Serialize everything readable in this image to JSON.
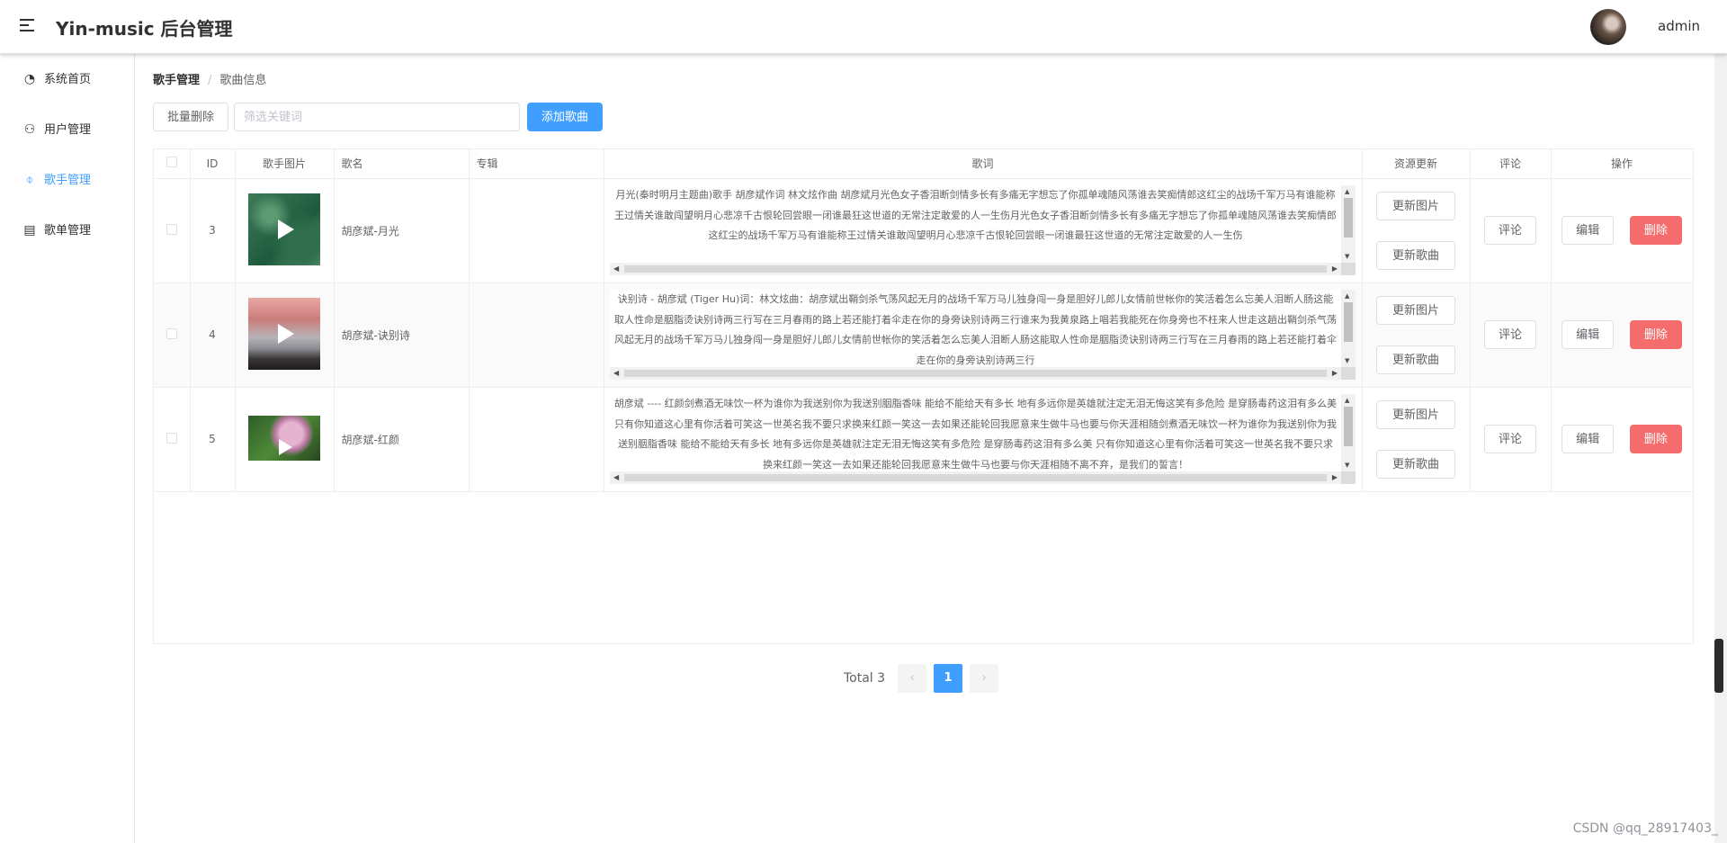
{
  "app": {
    "title": "Yin-music 后台管理",
    "user": "admin"
  },
  "sidebar": {
    "items": [
      {
        "label": "系统首页",
        "icon": "pie-chart-icon"
      },
      {
        "label": "用户管理",
        "icon": "user-icon"
      },
      {
        "label": "歌手管理",
        "icon": "microphone-icon",
        "active": true
      },
      {
        "label": "歌单管理",
        "icon": "document-icon"
      }
    ]
  },
  "breadcrumb": {
    "parent": "歌手管理",
    "sep": "/",
    "current": "歌曲信息"
  },
  "toolbar": {
    "batch_delete": "批量删除",
    "search_placeholder": "筛选关键词",
    "add_song": "添加歌曲"
  },
  "table": {
    "columns": [
      "",
      "ID",
      "歌手图片",
      "歌名",
      "专辑",
      "歌词",
      "资源更新",
      "评论",
      "操作"
    ],
    "buttons": {
      "update_image": "更新图片",
      "update_song": "更新歌曲",
      "comment": "评论",
      "edit": "编辑",
      "delete": "删除"
    },
    "rows": [
      {
        "id": "3",
        "name": "胡彦斌-月光",
        "album": "",
        "lyrics": "月光(秦时明月主题曲)歌手 胡彦斌作词 林文炫作曲 胡彦斌月光色女子香泪断剑情多长有多痛无字想忘了你孤单魂随风荡谁去笑痴情郎这红尘的战场千军万马有谁能称王过情关谁敢闯望明月心悲凉千古恨轮回尝眼一闭谁最狂这世道的无常注定敢爱的人一生伤月光色女子香泪断剑情多长有多痛无字想忘了你孤单魂随风荡谁去笑痴情郎这红尘的战场千军万马有谁能称王过情关谁敢闯望明月心悲凉千古恨轮回尝眼一闭谁最狂这世道的无常注定敢爱的人一生伤"
      },
      {
        "id": "4",
        "name": "胡彦斌-诀别诗",
        "album": "",
        "lyrics": "诀别诗 - 胡彦斌 (Tiger Hu)词：林文炫曲：胡彦斌出鞘剑杀气荡风起无月的战场千军万马儿独身闯一身是胆好儿郎儿女情前世帐你的笑活着怎么忘美人泪断人肠这能取人性命是胭脂烫诀别诗两三行写在三月春雨的路上若还能打着伞走在你的身旁诀别诗两三行谁来为我黄泉路上唱若我能死在你身旁也不枉来人世走这趟出鞘剑杀气荡风起无月的战场千军万马儿独身闯一身是胆好儿郎儿女情前世帐你的笑活着怎么忘美人泪断人肠这能取人性命是胭脂烫诀别诗两三行写在三月春雨的路上若还能打着伞走在你的身旁诀别诗两三行"
      },
      {
        "id": "5",
        "name": "胡彦斌-红颜",
        "album": "",
        "lyrics": "胡彦斌 ---- 红颜剑煮酒无味饮一杯为谁你为我送别你为我送别胭脂香味 能给不能给天有多长 地有多远你是英雄就注定无泪无悔这笑有多危险 是穿肠毒药这泪有多么美 只有你知道这心里有你活着可笑这一世英名我不要只求换来红颜一笑这一去如果还能轮回我愿意来生做牛马也要与你天涯相随剑煮酒无味饮一杯为谁你为我送别你为我送别胭脂香味 能给不能给天有多长 地有多远你是英雄就注定无泪无悔这笑有多危险 是穿肠毒药这泪有多么美 只有你知道这心里有你活着可笑这一世英名我不要只求换来红颜一笑这一去如果还能轮回我愿意来生做牛马也要与你天涯相随不离不弃，是我们的誓言！"
      }
    ]
  },
  "pagination": {
    "total": "Total 3",
    "prev": "‹",
    "page": "1",
    "next": "›"
  },
  "watermark": "CSDN @qq_28917403_",
  "colors": {
    "accent": "#409eff",
    "danger": "#f56c6c"
  }
}
